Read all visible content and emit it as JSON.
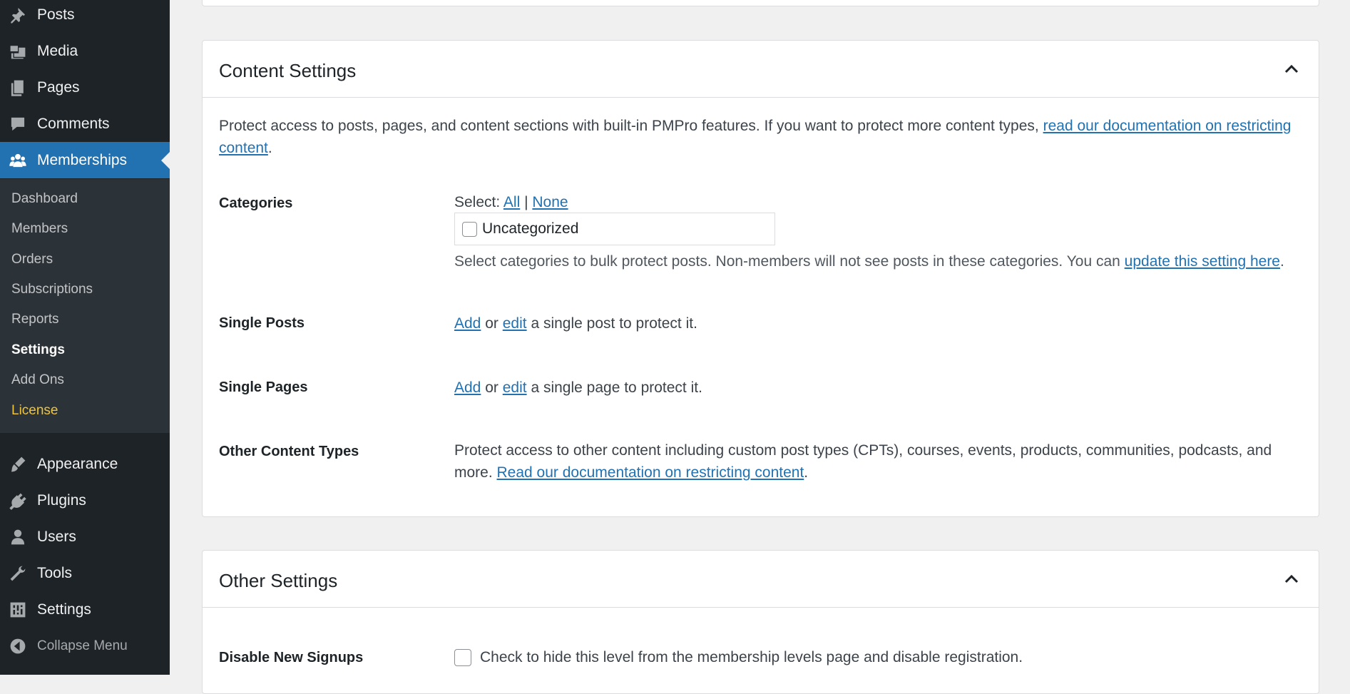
{
  "sidebar": {
    "top_items": [
      {
        "label": "Posts",
        "icon": "pin-icon"
      },
      {
        "label": "Media",
        "icon": "media-icon"
      },
      {
        "label": "Pages",
        "icon": "pages-icon"
      },
      {
        "label": "Comments",
        "icon": "comments-icon"
      },
      {
        "label": "Memberships",
        "icon": "groups-icon"
      }
    ],
    "submenu": [
      "Dashboard",
      "Members",
      "Orders",
      "Subscriptions",
      "Reports",
      "Settings",
      "Add Ons",
      "License"
    ],
    "bottom_items": [
      {
        "label": "Appearance",
        "icon": "brush-icon"
      },
      {
        "label": "Plugins",
        "icon": "plugin-icon"
      },
      {
        "label": "Users",
        "icon": "user-icon"
      },
      {
        "label": "Tools",
        "icon": "wrench-icon"
      },
      {
        "label": "Settings",
        "icon": "settings-icon"
      }
    ],
    "collapse_label": "Collapse Menu",
    "accent_color": "#2271b1",
    "license_color": "#f0c33c"
  },
  "content_settings": {
    "title": "Content Settings",
    "intro_text": "Protect access to posts, pages, and content sections with built-in PMPro features. If you want to protect more content types, ",
    "intro_link": "read our documentation on restricting content",
    "intro_end": ".",
    "categories": {
      "label": "Categories",
      "select_prefix": "Select:",
      "select_all": "All",
      "separator": "|",
      "select_none": "None",
      "options": [
        "Uncategorized"
      ],
      "help_text": "Select categories to bulk protect posts. Non-members will not see posts in these categories. You can ",
      "help_link": "update this setting here",
      "help_end": "."
    },
    "single_posts": {
      "label": "Single Posts",
      "add": "Add",
      "or": "or",
      "edit": "edit",
      "rest": "a single post to protect it."
    },
    "single_pages": {
      "label": "Single Pages",
      "add": "Add",
      "or": "or",
      "edit": "edit",
      "rest": "a single page to protect it."
    },
    "other_content": {
      "label": "Other Content Types",
      "text": "Protect access to other content including custom post types (CPTs), courses, events, products, communities, podcasts, and more. ",
      "link": "Read our documentation on restricting content",
      "end": "."
    }
  },
  "other_settings": {
    "title": "Other Settings",
    "disable_signups": {
      "label": "Disable New Signups",
      "checkbox_text": "Check to hide this level from the membership levels page and disable registration."
    }
  }
}
